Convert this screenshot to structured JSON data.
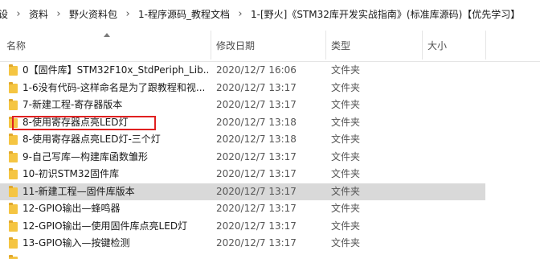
{
  "breadcrumb": {
    "items": [
      "设",
      "资料",
      "野火资料包",
      "1-程序源码_教程文档",
      "1-[野火]《STM32库开发实战指南》(标准库源码)【优先学习】"
    ],
    "separator": "›"
  },
  "columns": {
    "name": "名称",
    "date": "修改日期",
    "type": "类型",
    "size": "大小"
  },
  "rows": [
    {
      "name": "0【固件库】STM32F10x_StdPeriph_Lib...",
      "date": "2020/12/7 16:06",
      "type": "文件夹"
    },
    {
      "name": "1-6没有代码-这样命名是为了跟教程和视...",
      "date": "2020/12/7 13:17",
      "type": "文件夹"
    },
    {
      "name": "7-新建工程-寄存器版本",
      "date": "2020/12/7 13:17",
      "type": "文件夹"
    },
    {
      "name": "8-使用寄存器点亮LED灯",
      "date": "2020/12/7 13:18",
      "type": "文件夹"
    },
    {
      "name": "8-使用寄存器点亮LED灯-三个灯",
      "date": "2020/12/7 13:18",
      "type": "文件夹"
    },
    {
      "name": "9-自己写库—构建库函数雏形",
      "date": "2020/12/7 13:17",
      "type": "文件夹"
    },
    {
      "name": "10-初识STM32固件库",
      "date": "2020/12/7 13:17",
      "type": "文件夹"
    },
    {
      "name": "11-新建工程—固件库版本",
      "date": "2020/12/7 13:17",
      "type": "文件夹",
      "selected": true
    },
    {
      "name": "12-GPIO输出—蜂鸣器",
      "date": "2020/12/7 13:17",
      "type": "文件夹"
    },
    {
      "name": "12-GPIO输出—使用固件库点亮LED灯",
      "date": "2020/12/7 13:17",
      "type": "文件夹"
    },
    {
      "name": "13-GPIO输入—按键检测",
      "date": "2020/12/7 13:17",
      "type": "文件夹"
    }
  ],
  "icons": {
    "folder": "folder-icon",
    "sort": "sort-up-icon"
  },
  "colors": {
    "folder": "#f5c542",
    "highlight_box": "#e02020",
    "selected_row": "#d9d9d9"
  }
}
